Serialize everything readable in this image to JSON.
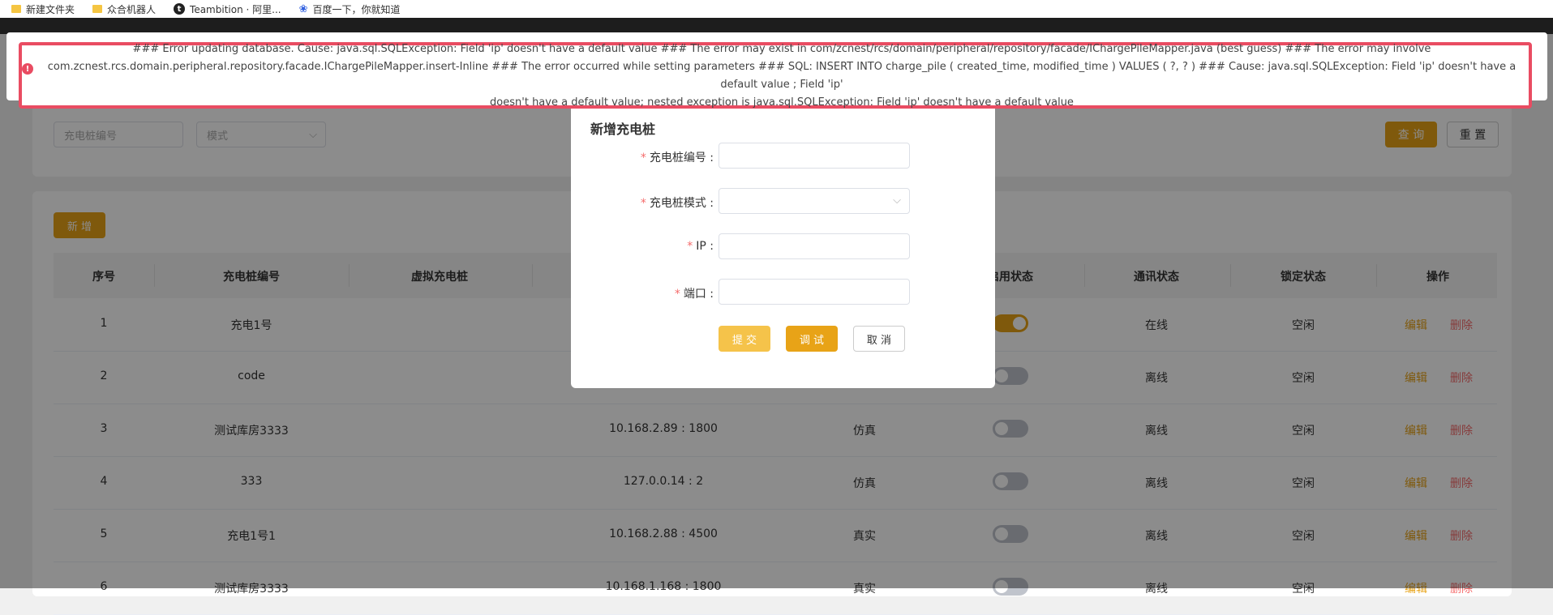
{
  "bookmarks": [
    {
      "label": "新建文件夹",
      "icon": "folder-icon"
    },
    {
      "label": "众合机器人",
      "icon": "folder-icon"
    },
    {
      "label": "Teambition · 阿里...",
      "icon": "teambition-icon"
    },
    {
      "label": "百度一下，你就知道",
      "icon": "baidu-paw-icon"
    }
  ],
  "search": {
    "code_placeholder": "充电桩编号",
    "mode_placeholder": "模式",
    "query_label": "查 询",
    "reset_label": "重 置"
  },
  "toolbar": {
    "add_label": "新 增"
  },
  "table": {
    "headers": [
      "序号",
      "充电桩编号",
      "虚拟充电桩",
      "",
      "",
      "启用状态",
      "通讯状态",
      "锁定状态",
      "操作"
    ],
    "edit_label": "编辑",
    "delete_label": "删除",
    "rows": [
      {
        "no": "1",
        "code": "充电1号",
        "address": "",
        "mode": "",
        "enabled": true,
        "comm": "在线",
        "lock": "空闲"
      },
      {
        "no": "2",
        "code": "code",
        "address": "",
        "mode": "",
        "enabled": false,
        "comm": "离线",
        "lock": "空闲"
      },
      {
        "no": "3",
        "code": "测试库房3333",
        "address": "10.168.2.89 : 1800",
        "mode": "仿真",
        "enabled": false,
        "comm": "离线",
        "lock": "空闲"
      },
      {
        "no": "4",
        "code": "333",
        "address": "127.0.0.14 : 2",
        "mode": "仿真",
        "enabled": false,
        "comm": "离线",
        "lock": "空闲"
      },
      {
        "no": "5",
        "code": "充电1号1",
        "address": "10.168.2.88 : 4500",
        "mode": "真实",
        "enabled": false,
        "comm": "离线",
        "lock": "空闲"
      },
      {
        "no": "6",
        "code": "测试库房3333",
        "address": "10.168.1.168 : 1800",
        "mode": "真实",
        "enabled": false,
        "comm": "离线",
        "lock": "空闲"
      }
    ]
  },
  "dialog": {
    "title": "新增充电桩",
    "fields": [
      {
        "label": "充电桩编号 :",
        "required": "*"
      },
      {
        "label": "充电桩模式 :",
        "required": "*"
      },
      {
        "label": "IP :",
        "required": "*"
      },
      {
        "label": "端口 :",
        "required": "*"
      }
    ],
    "submit_label": "提 交",
    "debug_label": "调 试",
    "cancel_label": "取 消"
  },
  "error": {
    "line1": "### Error updating database. Cause: java.sql.SQLException: Field 'ip' doesn't have a default value ### The error may exist in com/zcnest/rcs/domain/peripheral/repository/facade/IChargePileMapper.java (best guess) ### The error may involve",
    "line2": "com.zcnest.rcs.domain.peripheral.repository.facade.IChargePileMapper.insert-Inline ### The error occurred while setting parameters ### SQL: INSERT INTO charge_pile ( created_time, modified_time ) VALUES ( ?, ? ) ### Cause: java.sql.SQLException: Field 'ip' doesn't have a default value ; Field 'ip'",
    "line3": "doesn't have a default value; nested exception is java.sql.SQLException: Field 'ip' doesn't have a default value"
  },
  "colors": {
    "accent": "#e8a317",
    "danger": "#f56c6c",
    "error_border": "#e94c62"
  }
}
